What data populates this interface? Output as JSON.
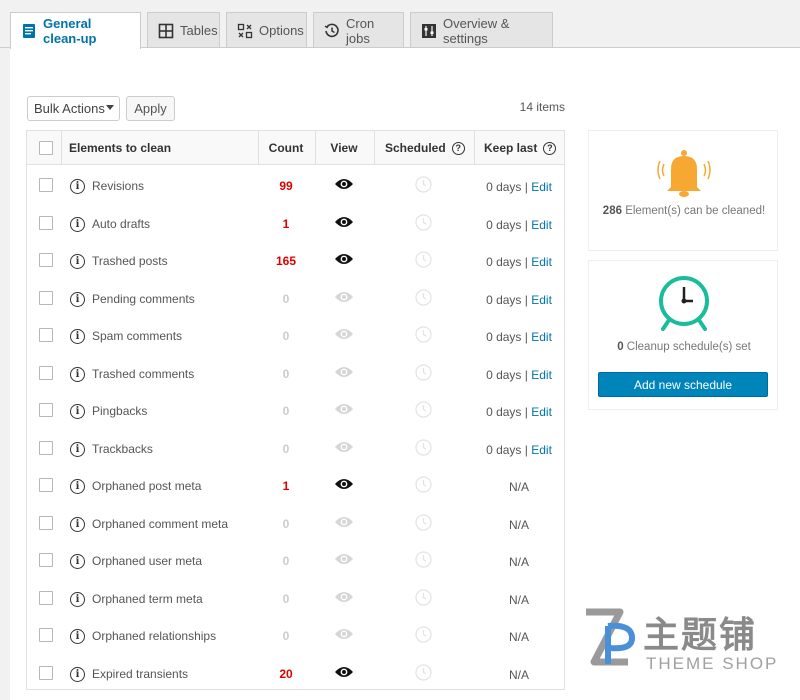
{
  "tabs": [
    {
      "label": "General clean-up",
      "icon": "document-lines-icon"
    },
    {
      "label": "Tables",
      "icon": "table-grid-icon"
    },
    {
      "label": "Options",
      "icon": "options-grid-icon"
    },
    {
      "label": "Cron jobs",
      "icon": "history-clock-icon"
    },
    {
      "label": "Overview & settings",
      "icon": "sliders-icon"
    }
  ],
  "toolbar": {
    "bulk_actions": "Bulk Actions",
    "apply": "Apply",
    "items_count": "14 items"
  },
  "table": {
    "headers": {
      "elements": "Elements to clean",
      "count": "Count",
      "view": "View",
      "scheduled": "Scheduled",
      "keep_last": "Keep last"
    },
    "rows": [
      {
        "name": "Revisions",
        "count": "99",
        "active": true,
        "keep": "0 days",
        "edit": "Edit"
      },
      {
        "name": "Auto drafts",
        "count": "1",
        "active": true,
        "keep": "0 days",
        "edit": "Edit"
      },
      {
        "name": "Trashed posts",
        "count": "165",
        "active": true,
        "keep": "0 days",
        "edit": "Edit"
      },
      {
        "name": "Pending comments",
        "count": "0",
        "active": false,
        "keep": "0 days",
        "edit": "Edit"
      },
      {
        "name": "Spam comments",
        "count": "0",
        "active": false,
        "keep": "0 days",
        "edit": "Edit"
      },
      {
        "name": "Trashed comments",
        "count": "0",
        "active": false,
        "keep": "0 days",
        "edit": "Edit"
      },
      {
        "name": "Pingbacks",
        "count": "0",
        "active": false,
        "keep": "0 days",
        "edit": "Edit"
      },
      {
        "name": "Trackbacks",
        "count": "0",
        "active": false,
        "keep": "0 days",
        "edit": "Edit"
      },
      {
        "name": "Orphaned post meta",
        "count": "1",
        "active": true,
        "keep": "N/A",
        "edit": ""
      },
      {
        "name": "Orphaned comment meta",
        "count": "0",
        "active": false,
        "keep": "N/A",
        "edit": ""
      },
      {
        "name": "Orphaned user meta",
        "count": "0",
        "active": false,
        "keep": "N/A",
        "edit": ""
      },
      {
        "name": "Orphaned term meta",
        "count": "0",
        "active": false,
        "keep": "N/A",
        "edit": ""
      },
      {
        "name": "Orphaned relationships",
        "count": "0",
        "active": false,
        "keep": "N/A",
        "edit": ""
      },
      {
        "name": "Expired transients",
        "count": "20",
        "active": true,
        "keep": "N/A",
        "edit": ""
      }
    ]
  },
  "sidebar": {
    "elements_count": "286",
    "elements_text": "Element(s) can be cleaned!",
    "schedules_count": "0",
    "schedules_text": "Cleanup schedule(s) set",
    "add_schedule": "Add new schedule"
  },
  "watermark": {
    "cn": "主题铺",
    "en": "THEME SHOP"
  },
  "colors": {
    "accent": "#0073aa",
    "button": "#0085ba",
    "count_red": "#dd0000",
    "bell": "#f7a833",
    "clock": "#1abc9c"
  }
}
